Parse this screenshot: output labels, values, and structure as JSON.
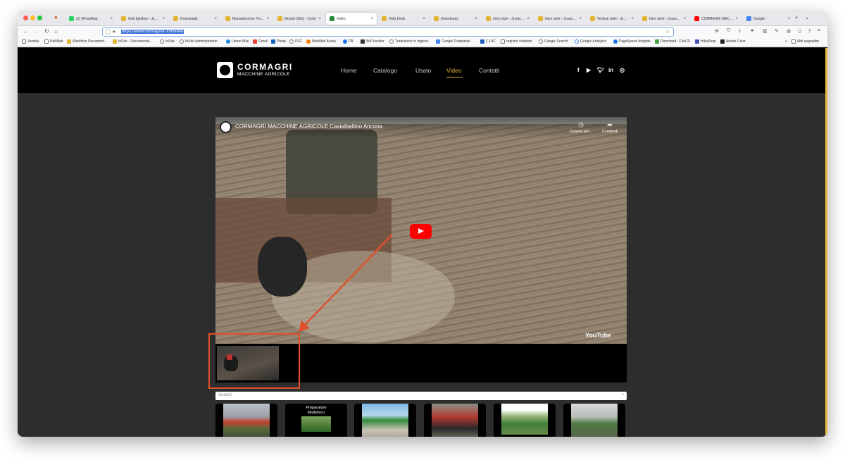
{
  "browser": {
    "tabs": [
      {
        "title": "(1) WhatsApp",
        "color": "#25d366"
      },
      {
        "title": "Grid lightbox - JLeav",
        "color": "#e2b634"
      },
      {
        "title": "Downloads",
        "color": "#e2b634"
      },
      {
        "title": "Manutenzione: Pulisci",
        "color": "#e2b634"
      },
      {
        "title": "Moduli (Sito) - Corm",
        "color": "#e2b634"
      },
      {
        "title": "Video",
        "color": "#2b8a3e",
        "active": true
      },
      {
        "title": "Help Desk",
        "color": "#e2b634"
      },
      {
        "title": "Downloads",
        "color": "#e2b634"
      },
      {
        "title": "Intro style - JLeavArt",
        "color": "#e2b634"
      },
      {
        "title": "Intro style - JLeavArt",
        "color": "#e2b634"
      },
      {
        "title": "Vertical style - JLeav",
        "color": "#e2b634"
      },
      {
        "title": "Intro style - JLeavArt",
        "color": "#e2b634"
      },
      {
        "title": "CORMAGRI MACCHINE",
        "color": "#ff0000"
      },
      {
        "title": "Google",
        "color": "#4285f4"
      }
    ],
    "url": "https://www.cormagrisrl.it/it/video",
    "bookmarks": [
      "Joomla",
      "KeliWeb",
      "Workflow Document...",
      "InSite - Documentat...",
      "InSite",
      "InSite Administration",
      "Libero Mail",
      "Gmail",
      "Posta",
      "PEC",
      "WebMail Aruba",
      "FB",
      "WeTransfer",
      "Traduzione in inglese",
      "Google Traduttore",
      "CJ AC",
      "registro visitatori",
      "Google Search",
      "Google Analytics",
      "PageSpeed Insights",
      "Download - FileCR",
      "HikaShop",
      "Adobe Color"
    ],
    "other_bookmarks": "Altri segnalibri"
  },
  "site": {
    "brand": "CORMAGRI",
    "brand_sub": "MACCHINE AGRICOLE",
    "menu": [
      "Home",
      "Catalogo",
      "Usato",
      "Video",
      "Contatti"
    ],
    "active_menu": "Video",
    "accent_color": "#e2b634",
    "social_icons": [
      "facebook-icon",
      "youtube-icon",
      "twitter-icon",
      "linkedin-icon",
      "instagram-icon"
    ]
  },
  "video": {
    "title": "CORMAGRI MACCHINE AGRICOLE Castelbellino Ancona",
    "watch_later": "Guarda più...",
    "share": "Condividi",
    "yt_logo": "YouTube"
  },
  "search": {
    "placeholder": "Search"
  },
  "gallery": {
    "second_caption": "Preparatore Multidisco"
  },
  "annotation": {
    "color": "#e0502a"
  }
}
